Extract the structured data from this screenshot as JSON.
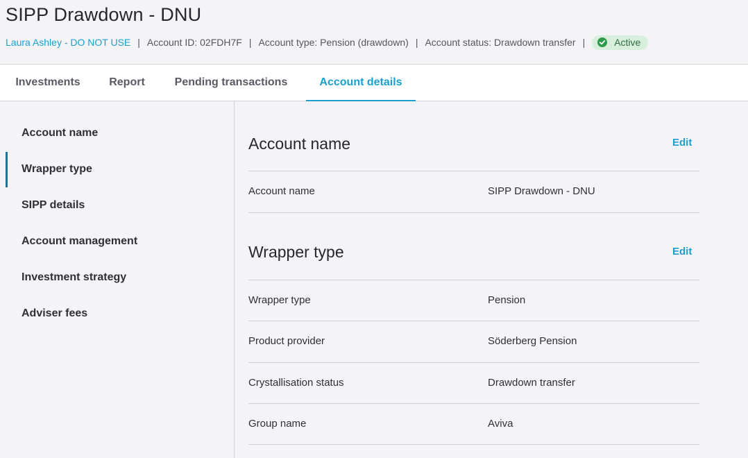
{
  "page": {
    "title": "SIPP Drawdown - DNU"
  },
  "meta": {
    "client_name": "Laura Ashley - DO NOT USE",
    "separator": "|",
    "account_id": "Account ID: 02FDH7F",
    "account_type": "Account type: Pension (drawdown)",
    "account_status": "Account status: Drawdown transfer",
    "status_badge": "Active"
  },
  "tabs": [
    {
      "label": "Investments",
      "active": false
    },
    {
      "label": "Report",
      "active": false
    },
    {
      "label": "Pending transactions",
      "active": false
    },
    {
      "label": "Account details",
      "active": true
    }
  ],
  "sidebar": {
    "selected": "Wrapper type",
    "items": [
      {
        "label": "Account name"
      },
      {
        "label": "Wrapper type"
      },
      {
        "label": "SIPP details"
      },
      {
        "label": "Account management"
      },
      {
        "label": "Investment strategy"
      },
      {
        "label": "Adviser fees"
      }
    ]
  },
  "sections": {
    "account_name": {
      "title": "Account name",
      "edit_label": "Edit",
      "rows": [
        {
          "label": "Account name",
          "value": "SIPP Drawdown - DNU"
        }
      ]
    },
    "wrapper_type": {
      "title": "Wrapper type",
      "edit_label": "Edit",
      "rows": [
        {
          "label": "Wrapper type",
          "value": "Pension"
        },
        {
          "label": "Product provider",
          "value": "Söderberg Pension"
        },
        {
          "label": "Crystallisation status",
          "value": "Drawdown transfer"
        },
        {
          "label": "Group name",
          "value": "Aviva"
        }
      ]
    }
  },
  "colors": {
    "accent": "#1a9fd0",
    "badge_bg": "#d9efde",
    "badge_icon": "#2e9a4a",
    "sidebar_indicator": "#1f6f8f",
    "page_bg": "#f4f4f6"
  },
  "icons": {
    "status": "check-circle-icon"
  }
}
